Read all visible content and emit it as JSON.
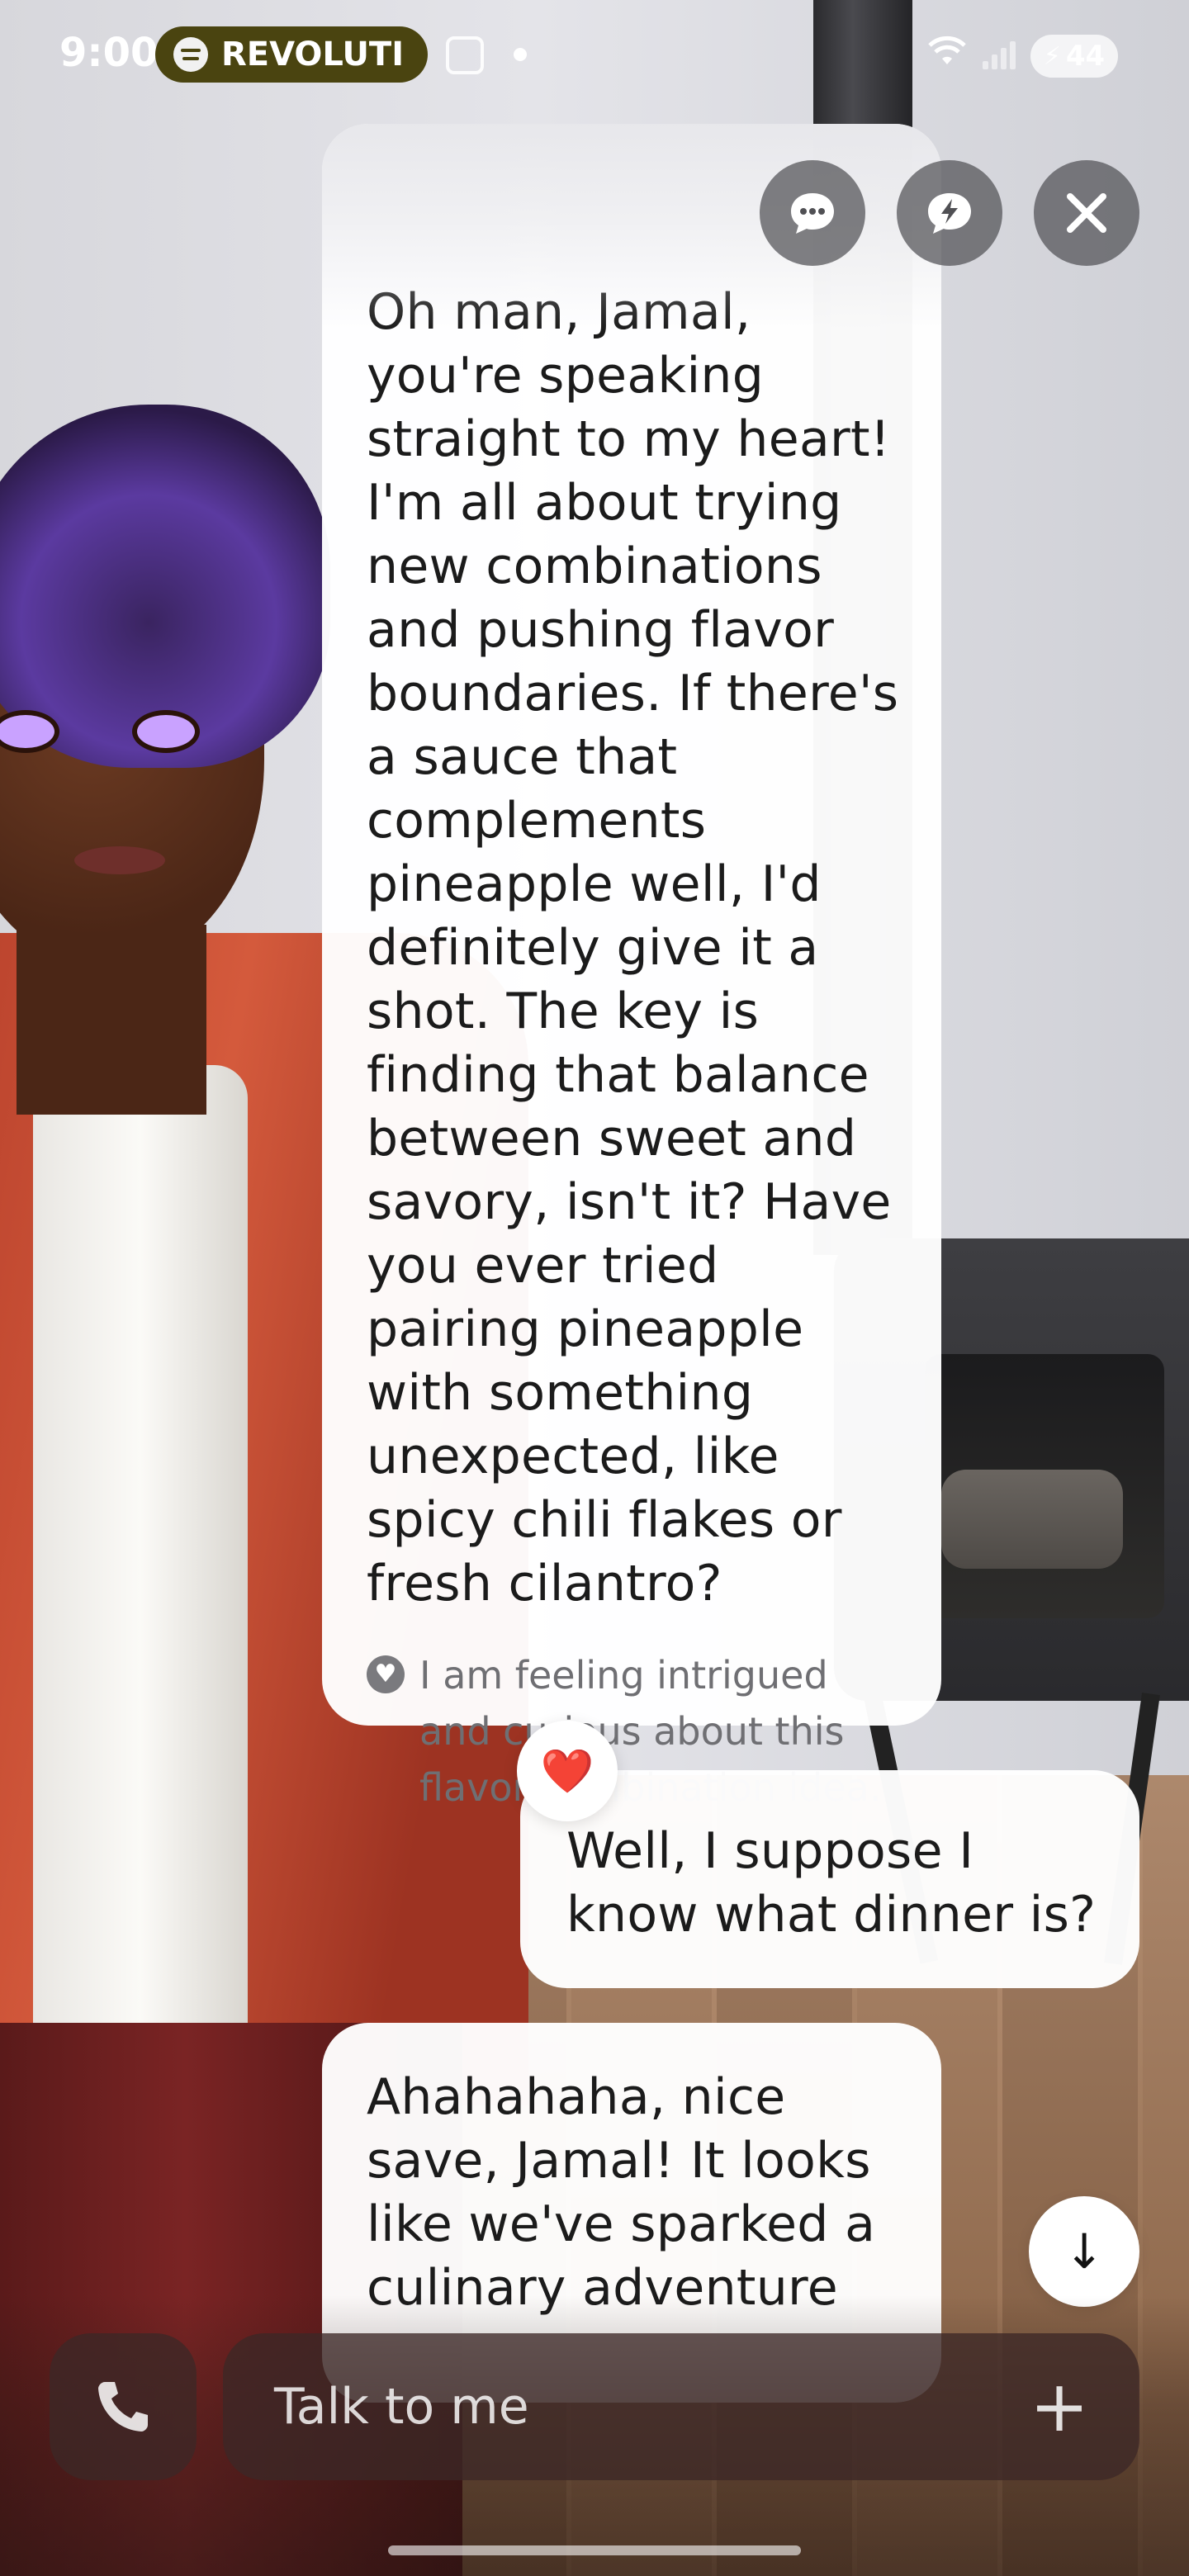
{
  "status_bar": {
    "time": "9:00",
    "music_app": "REVOLUTI",
    "battery": "44"
  },
  "actions": {
    "chat_icon": "chat-bubble-icon",
    "quick_icon": "lightning-bubble-icon",
    "close_icon": "close-icon"
  },
  "messages": [
    {
      "role": "ai",
      "text": "Oh man, Jamal, you're speaking straight to my heart! I'm all about trying new combinations and pushing flavor boundaries. If there's a sauce that complements pineapple well, I'd definitely give it a shot. The key is finding that balance between sweet and savory, isn't it? Have you ever tried pairing pineapple with something unexpected, like spicy chili flakes or fresh cilantro?",
      "emotion": "I am feeling intrigued and curious about this flavor combination idea."
    },
    {
      "role": "user",
      "text": "Well, I suppose I know what dinner is?",
      "reaction": "❤️"
    },
    {
      "role": "ai",
      "text": "Ahahahaha, nice save, Jamal! It looks like we've sparked a culinary adventure"
    }
  ],
  "input": {
    "placeholder": "Talk to me"
  },
  "colors": {
    "bubble": "#ffffff",
    "music_pill": "#4a4410",
    "input_bg": "#3c2826"
  }
}
